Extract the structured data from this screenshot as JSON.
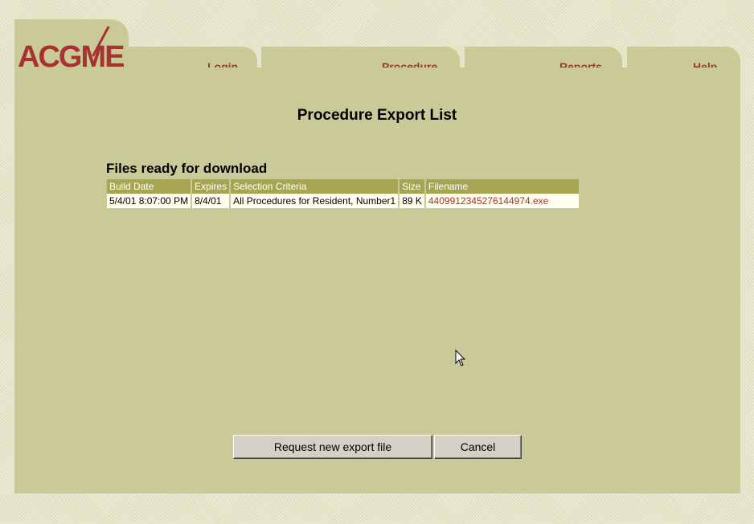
{
  "logo": {
    "text": "ACGME"
  },
  "nav": {
    "tabs": [
      {
        "label": "Login"
      },
      {
        "label": "Procedure"
      },
      {
        "label": "Reports"
      },
      {
        "label": "Help"
      }
    ]
  },
  "page": {
    "title": "Procedure Export List",
    "section_title": "Files ready for download"
  },
  "table": {
    "headers": [
      "Build Date",
      "Expires",
      "Selection Criteria",
      "Size",
      "Filename"
    ],
    "rows": [
      {
        "build_date": "5/4/01 8:07:00 PM",
        "expires": "8/4/01",
        "criteria": "All Procedures for Resident, Number1",
        "size": "89 K",
        "filename": "4409912345276144974.exe"
      }
    ]
  },
  "buttons": {
    "request": "Request new export file",
    "cancel": "Cancel"
  },
  "colors": {
    "panel": "#caca99",
    "header": "#a5a552",
    "link": "#a83232"
  }
}
